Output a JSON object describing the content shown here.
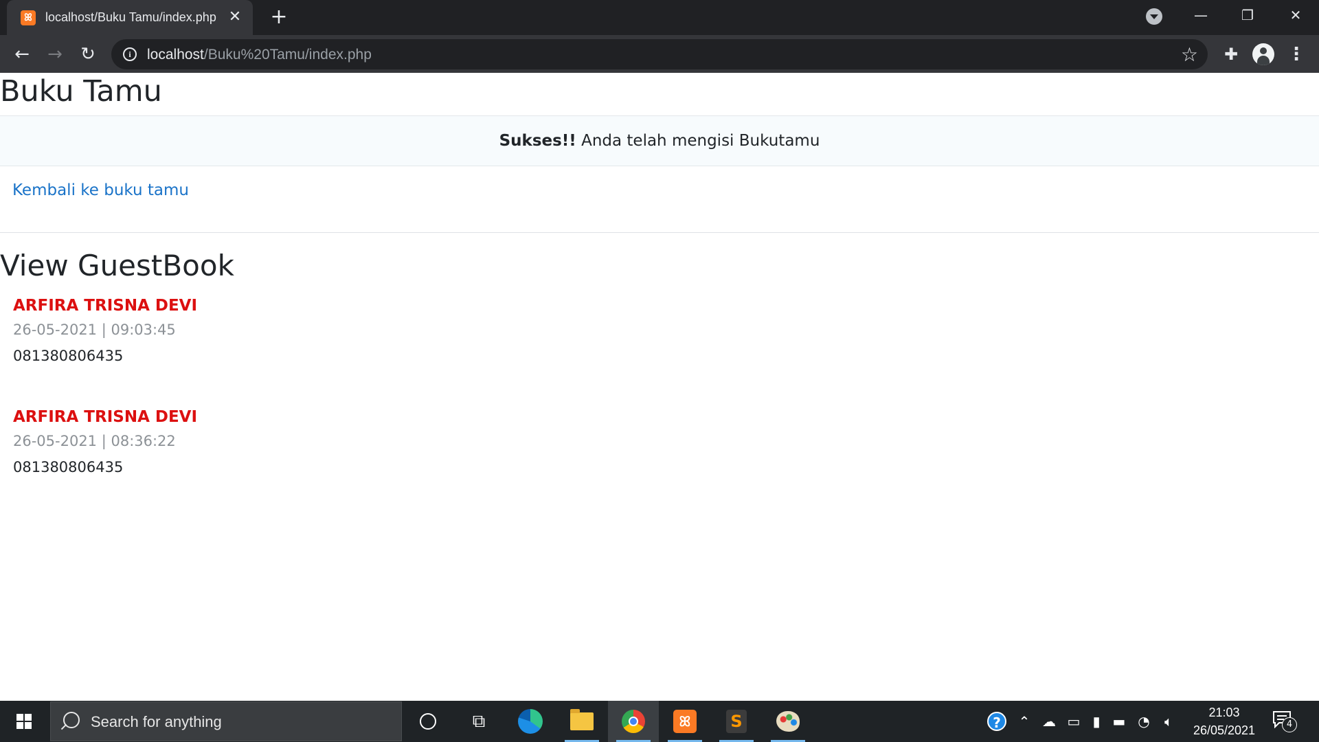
{
  "browser": {
    "tab_title": "localhost/Buku Tamu/index.php",
    "tab_favicon": "xampp-icon",
    "url_host": "localhost",
    "url_path": "/Buku%20Tamu/index.php"
  },
  "page": {
    "title": "Buku Tamu",
    "alert_strong": "Sukses!!",
    "alert_text": " Anda telah mengisi Bukutamu",
    "back_link": "Kembali ke buku tamu",
    "section_title": "View GuestBook",
    "entries": [
      {
        "name": "ARFIRA TRISNA DEVI",
        "datetime": "26-05-2021 | 09:03:45",
        "message": "081380806435"
      },
      {
        "name": "ARFIRA TRISNA DEVI",
        "datetime": "26-05-2021 | 08:36:22",
        "message": "081380806435"
      }
    ]
  },
  "taskbar": {
    "search_placeholder": "Search for anything",
    "time": "21:03",
    "date": "26/05/2021",
    "notification_count": "4",
    "pinned_apps": [
      "cortana-icon",
      "task-view-icon",
      "edge-icon",
      "file-explorer-icon",
      "chrome-icon",
      "xampp-icon",
      "sublime-text-icon",
      "paint-icon"
    ]
  },
  "colors": {
    "entry_name": "#dc1010",
    "link": "#1a73c8",
    "browser_dark": "#202124",
    "toolbar": "#35363a"
  }
}
